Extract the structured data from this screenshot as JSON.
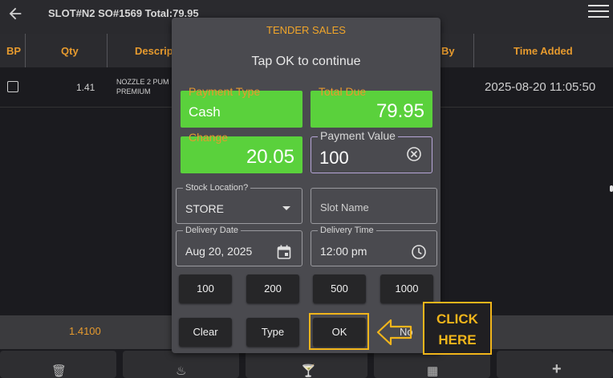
{
  "header": {
    "title": "SLOT#N2 SO#1569 Total:79.95"
  },
  "table": {
    "columns": [
      "BP",
      "Qty",
      "Descrip",
      "By",
      "Time Added"
    ],
    "rows": [
      {
        "qty": "1.41",
        "desc_line1": "NOZZLE 2 PUM",
        "desc_line2": "PREMIUM",
        "time_added": "2025-08-20 11:05:50"
      }
    ]
  },
  "summary": {
    "qty": "1.4100"
  },
  "bottom_actions": [
    {
      "icon": "trash-icon",
      "glyph": "🗑"
    },
    {
      "icon": "bowl-icon",
      "glyph": "♨"
    },
    {
      "icon": "cocktail-icon",
      "glyph": "🍸"
    },
    {
      "icon": "calculator-icon",
      "glyph": "▦"
    },
    {
      "icon": "plus-icon",
      "glyph": "+"
    }
  ],
  "dialog": {
    "title": "TENDER SALES",
    "message": "Tap OK to continue",
    "payment_type": {
      "label": "Payment Type",
      "value": "Cash"
    },
    "total_due": {
      "label": "Total Due",
      "value": "79.95"
    },
    "change": {
      "label": "Change",
      "value": "20.05"
    },
    "payment_value": {
      "label": "Payment Value",
      "value": "100"
    },
    "stock_location": {
      "label": "Stock Location?",
      "value": "STORE"
    },
    "slot_name": {
      "placeholder": "Slot Name"
    },
    "delivery_date": {
      "label": "Delivery Date",
      "value": "Aug 20, 2025"
    },
    "delivery_time": {
      "label": "Delivery Time",
      "value": "12:00 pm"
    },
    "amount_buttons": [
      "100",
      "200",
      "500",
      "1000"
    ],
    "action_buttons": {
      "clear": "Clear",
      "type": "Type",
      "ok": "OK",
      "no": "No"
    }
  },
  "callout": {
    "line1": "CLICK",
    "line2": "HERE"
  },
  "colors": {
    "accent_orange": "#e69a2e",
    "highlight_yellow": "#f1b51b",
    "green": "#5ad13c",
    "dialog_bg": "#4a4a4f"
  }
}
